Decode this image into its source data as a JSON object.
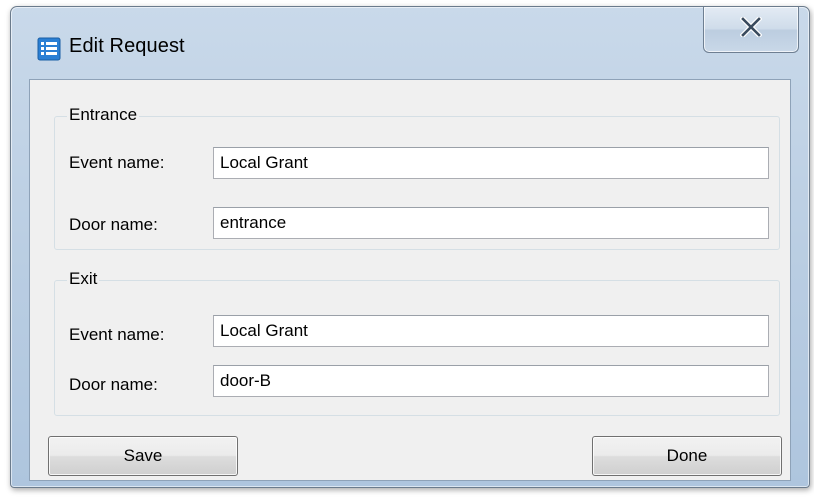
{
  "window": {
    "title": "Edit Request",
    "icon": "app-list-icon",
    "close_icon": "close-x-icon"
  },
  "entrance": {
    "legend": "Entrance",
    "event_label": "Event name:",
    "event_value": "Local Grant",
    "door_label": "Door name:",
    "door_value": "entrance"
  },
  "exit": {
    "legend": "Exit",
    "event_label": "Event name:",
    "event_value": "Local Grant",
    "door_label": "Door name:",
    "door_value": "door-B"
  },
  "buttons": {
    "save_label": "Save",
    "done_label": "Done"
  },
  "colors": {
    "frame": "#b9cde2",
    "client": "#f0f0f0",
    "icon_blue": "#2a7fd4"
  }
}
